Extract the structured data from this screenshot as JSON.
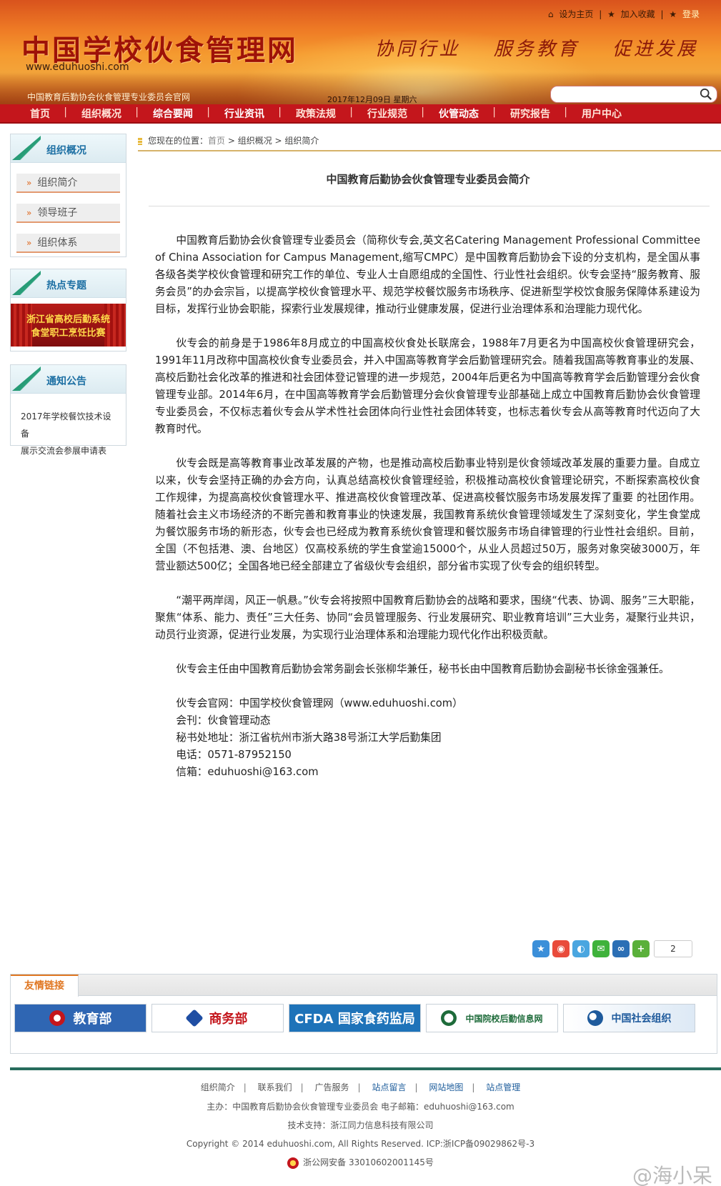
{
  "header": {
    "top_links": {
      "homepage": "设为主页",
      "favorite": "加入收藏",
      "login": "登录"
    },
    "site_title": "中国学校伙食管理网",
    "site_url": "www.eduhuoshi.com",
    "slogan": [
      "协同行业",
      "服务教育",
      "促进发展"
    ],
    "subtitle": "中国教育后勤协会伙食管理专业委员会官网",
    "date": "2017年12月09日  星期六",
    "search_placeholder": ""
  },
  "nav": {
    "items": [
      "首页",
      "组织概况",
      "综合要闻",
      "行业资讯",
      "政策法规",
      "行业规范",
      "伙管动态",
      "研究报告",
      "用户中心"
    ]
  },
  "sidebar": {
    "org": {
      "title": "组织概况",
      "items": [
        "组织简介",
        "领导班子",
        "组织体系"
      ]
    },
    "hot": {
      "title": "热点专题",
      "banner_line1": "浙江省高校后勤系统",
      "banner_line2": "食堂职工烹饪比赛"
    },
    "notice": {
      "title": "通知公告",
      "line1": "2017年学校餐饮技术设备",
      "line2": "展示交流会参展申请表"
    }
  },
  "breadcrumb": {
    "prefix": "您现在的位置：",
    "home": "首页",
    "sep": " > ",
    "level1": "组织概况",
    "level2": "组织简介"
  },
  "article": {
    "title": "中国教育后勤协会伙食管理专业委员会简介",
    "paragraphs": [
      "中国教育后勤协会伙食管理专业委员会（简称伙专会,英文名Catering Management Professional Committee of China Association for Campus Management,缩写CMPC）是中国教育后勤协会下设的分支机构，是全国从事各级各类学校伙食管理和研究工作的单位、专业人士自愿组成的全国性、行业性社会组织。伙专会坚持“服务教育、服务会员”的办会宗旨，以提高学校伙食管理水平、规范学校餐饮服务市场秩序、促进新型学校饮食服务保障体系建设为目标，发挥行业协会职能，探索行业发展规律，推动行业健康发展，促进行业治理体系和治理能力现代化。",
      "伙专会的前身是于1986年8月成立的中国高校伙食处长联席会，1988年7月更名为中国高校伙食管理研究会，1991年11月改称中国高校伙食专业委员会，并入中国高等教育学会后勤管理研究会。随着我国高等教育事业的发展、高校后勤社会化改革的推进和社会团体登记管理的进一步规范，2004年后更名为中国高等教育学会后勤管理分会伙食管理专业部。2014年6月，在中国高等教育学会后勤管理分会伙食管理专业部基础上成立中国教育后勤协会伙食管理专业委员会，不仅标志着伙专会从学术性社会团体向行业性社会团体转变，也标志着伙专会从高等教育时代迈向了大教育时代。",
      "伙专会既是高等教育事业改革发展的产物，也是推动高校后勤事业特别是伙食领域改革发展的重要力量。自成立以来，伙专会坚持正确的办会方向，认真总结高校伙食管理经验，积极推动高校伙食管理论研究，不断探索高校伙食工作规律，为提高高校伙食管理水平、推进高校伙食管理改革、促进高校餐饮服务市场发展发挥了重要 的社团作用。随着社会主义市场经济的不断完善和教育事业的快速发展，我国教育系统伙食管理领域发生了深刻变化，学生食堂成为餐饮服务市场的新形态，伙专会也已经成为教育系统伙食管理和餐饮服务市场自律管理的行业性社会组织。目前，全国（不包括港、澳、台地区）仅高校系统的学生食堂逾15000个，从业人员超过50万，服务对象突破3000万，年营业额达500亿；全国各地已经全部建立了省级伙专会组织，部分省市实现了伙专会的组织转型。",
      "“潮平两岸阔，风正一帆悬。”伙专会将按照中国教育后勤协会的战略和要求，围绕“代表、协调、服务”三大职能，聚焦“体系、能力、责任”三大任务、协同“会员管理服务、行业发展研究、职业教育培训”三大业务，凝聚行业共识，动员行业资源，促进行业发展，为实现行业治理体系和治理能力现代化作出积极贡献。",
      "伙专会主任由中国教育后勤协会常务副会长张柳华兼任，秘书长由中国教育后勤协会副秘书长徐金强兼任。"
    ],
    "contact": {
      "website": "伙专会官网：中国学校伙食管理网（www.eduhuoshi.com）",
      "journal": "会刊：伙食管理动态",
      "address": "秘书处地址：浙江省杭州市浙大路38号浙江大学后勤集团",
      "phone": "电话：0571-87952150",
      "email": "信箱：eduhuoshi@163.com"
    }
  },
  "share": {
    "count": "2",
    "icons": [
      "qzone-icon",
      "weibo-icon",
      "tqq-icon",
      "wechat-icon",
      "renren-icon",
      "more-icon"
    ]
  },
  "friend_links": {
    "tab": "友情链接",
    "logos": [
      {
        "name": "moe",
        "text": "教育部"
      },
      {
        "name": "mofcom",
        "text": "商务部"
      },
      {
        "name": "cfda",
        "text": "CFDA 国家食药监局"
      },
      {
        "name": "hqnet",
        "text": "中国院校后勤信息网"
      },
      {
        "name": "ngo",
        "text": "中国社会组织"
      }
    ]
  },
  "footer": {
    "links": [
      "组织简介",
      "联系我们",
      "广告服务",
      "站点留言",
      "网站地图",
      "站点管理"
    ],
    "sponsor": "主办：中国教育后勤协会伙食管理专业委员会  电子邮箱：eduhuoshi@163.com",
    "tech": "技术支持：浙江同力信息科技有限公司",
    "copyright": "Copyright © 2014 eduhuoshi.com, All Rights Reserved. ICP:浙ICP备09029862号-3",
    "police": "浙公网安备 33010602001145号",
    "watermark": "@海小呆"
  },
  "colors": {
    "nav_red": "#c4161c",
    "accent_orange": "#e07722",
    "link_blue": "#1c5c9b",
    "footer_green": "#276c5d"
  }
}
